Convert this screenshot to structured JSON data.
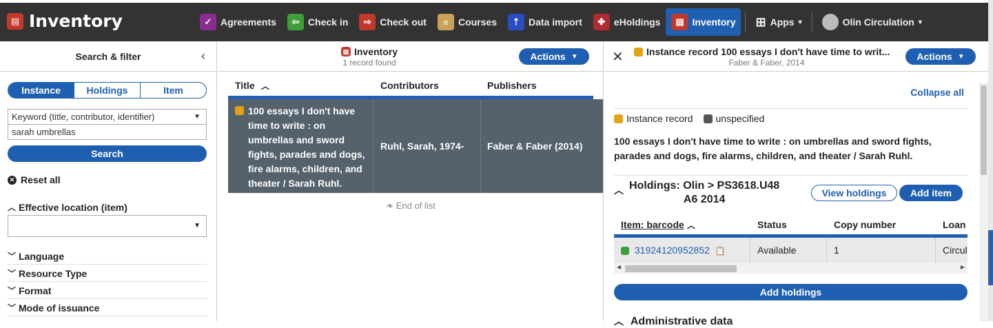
{
  "app": {
    "title": "Inventory"
  },
  "nav": {
    "items": [
      {
        "label": "Agreements",
        "icon": "agreements-icon",
        "color": "#8a2d8f"
      },
      {
        "label": "Check in",
        "icon": "check-in-icon",
        "color": "#3f9e3a"
      },
      {
        "label": "Check out",
        "icon": "check-out-icon",
        "color": "#c0392b"
      },
      {
        "label": "Courses",
        "icon": "courses-icon",
        "color": "#c9a15a"
      },
      {
        "label": "Data import",
        "icon": "data-import-icon",
        "color": "#2a4dc4"
      },
      {
        "label": "eHoldings",
        "icon": "eholdings-icon",
        "color": "#b02a30"
      },
      {
        "label": "Inventory",
        "icon": "inventory-icon",
        "color": "#c0392b",
        "active": true
      }
    ],
    "apps_label": "Apps",
    "user_label": "Olin Circulation"
  },
  "filter_pane": {
    "title": "Search & filter",
    "segments": [
      "Instance",
      "Holdings",
      "Item"
    ],
    "search_option": "Keyword (title, contributor, identifier)",
    "search_value": "sarah umbrellas",
    "search_button": "Search",
    "reset_label": "Reset all",
    "effective_location": "Effective location (item)",
    "filters": [
      "Language",
      "Resource Type",
      "Format",
      "Mode of issuance"
    ]
  },
  "results_pane": {
    "title": "Inventory",
    "subtitle": "1 record found",
    "actions_label": "Actions",
    "columns": [
      "Title",
      "Contributors",
      "Publishers"
    ],
    "rows": [
      {
        "title": "100 essays I don't have time to write : on umbrellas and sword fights, parades and dogs, fire alarms, children, and theater / Sarah Ruhl.",
        "contributors": "Ruhl, Sarah, 1974-",
        "publishers": "Faber & Faber (2014)"
      }
    ],
    "end_of_list": "End of list"
  },
  "detail_pane": {
    "title": "Instance record 100 essays I don't have time to writ...",
    "subtitle": "Faber & Faber, 2014",
    "actions_label": "Actions",
    "collapse_all": "Collapse all",
    "record_type": "Instance record",
    "status": "unspecified",
    "full_title": "100 essays I don't have time to write : on umbrellas and sword fights, parades and dogs, fire alarms, children, and theater / Sarah Ruhl.",
    "holdings": {
      "label_line1": "Holdings: Olin > PS3618.U48",
      "label_line2": "A6 2014",
      "view_button": "View holdings",
      "add_item_button": "Add item",
      "columns": [
        "Item: barcode",
        "Status",
        "Copy number",
        "Loan"
      ],
      "items": [
        {
          "barcode": "31924120952852",
          "status": "Available",
          "copy_number": "1",
          "loan": "Circul"
        }
      ]
    },
    "add_holdings_button": "Add holdings",
    "admin_data_label": "Administrative data"
  }
}
